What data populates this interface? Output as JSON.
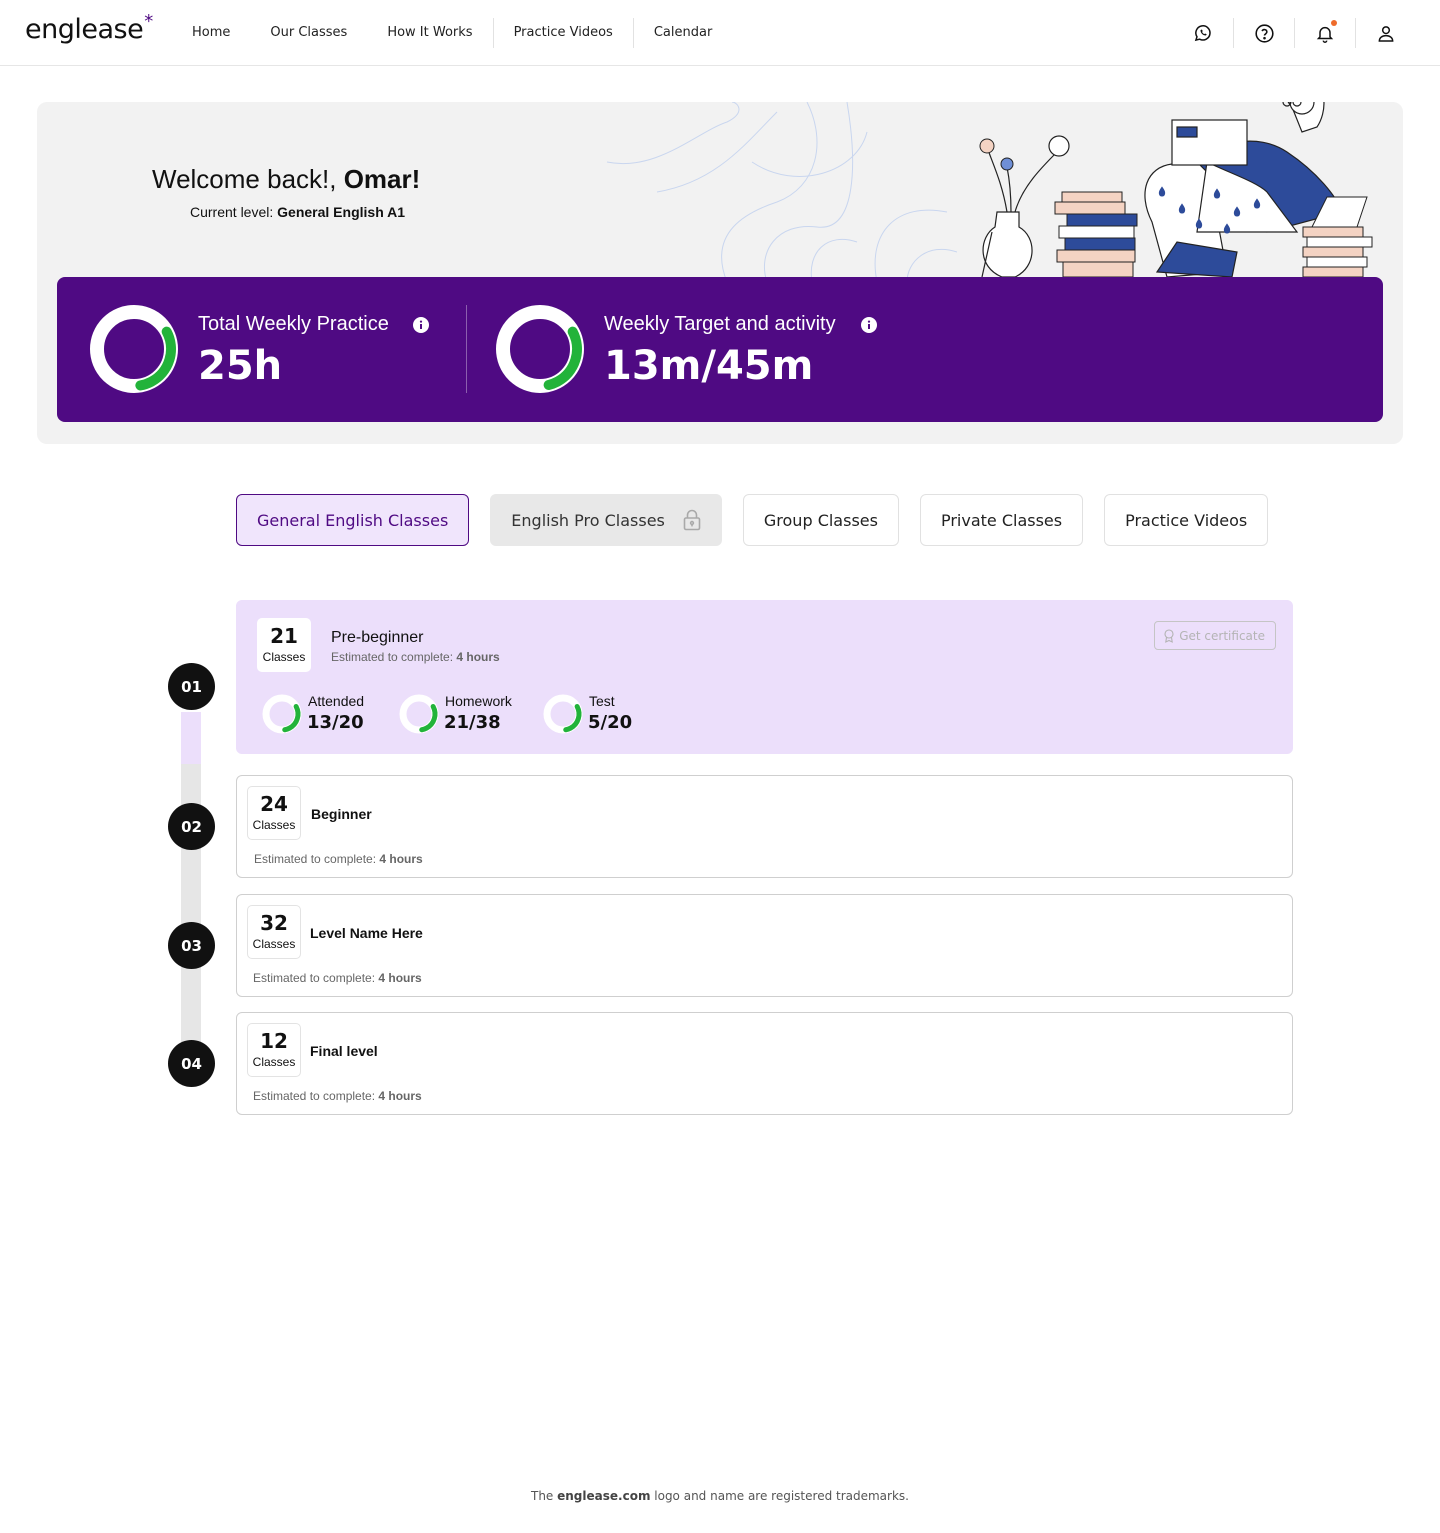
{
  "nav": {
    "logo": "englease",
    "logo_mark": "*",
    "links": [
      "Home",
      "Our Classes",
      "How It Works",
      "Practice Videos",
      "Calendar"
    ],
    "icons": [
      "whatsapp-icon",
      "help-icon",
      "bell-icon",
      "user-icon"
    ]
  },
  "hero": {
    "welcome_prefix": "Welcome back!, ",
    "user_name": "Omar!",
    "level_prefix": "Current level: ",
    "level_value": "General English A1",
    "stats": [
      {
        "label": "Total Weekly Practice",
        "value": "25h",
        "progress": 0.3
      },
      {
        "label": "Weekly Target and activity",
        "value": "13m/45m",
        "progress": 0.29
      }
    ]
  },
  "tabs": [
    {
      "label": "General English Classes",
      "state": "active"
    },
    {
      "label": "English Pro Classes",
      "state": "locked"
    },
    {
      "label": "Group Classes",
      "state": "normal"
    },
    {
      "label": "Private Classes",
      "state": "normal"
    },
    {
      "label": "Practice Videos",
      "state": "normal"
    }
  ],
  "levels": [
    {
      "step": "01",
      "count": "21",
      "count_label": "Classes",
      "name": "Pre-beginner",
      "est_prefix": "Estimated to complete: ",
      "est_value": "4 hours",
      "certificate": "Get certificate",
      "metrics": [
        {
          "label": "Attended",
          "value": "13/20",
          "progress": 0.3
        },
        {
          "label": "Homework",
          "value": "21/38",
          "progress": 0.3
        },
        {
          "label": "Test",
          "value": "5/20",
          "progress": 0.3
        }
      ]
    },
    {
      "step": "02",
      "count": "24",
      "count_label": "Classes",
      "name": "Beginner",
      "est_prefix": "Estimated to complete: ",
      "est_value": "4 hours"
    },
    {
      "step": "03",
      "count": "32",
      "count_label": "Classes",
      "name": "Level Name Here",
      "est_prefix": "Estimated to complete: ",
      "est_value": "4 hours"
    },
    {
      "step": "04",
      "count": "12",
      "count_label": "Classes",
      "name": "Final level",
      "est_prefix": "Estimated to complete: ",
      "est_value": "4 hours"
    }
  ],
  "footer": {
    "prefix": "The ",
    "brand": "englease.com",
    "suffix": " logo and name are registered trademarks."
  },
  "colors": {
    "brand_purple": "#4f0a83",
    "active_bg": "#ecdffb",
    "progress_green": "#22b33a",
    "accent_blue": "#2d4b9a",
    "accent_peach": "#f4d3c3"
  }
}
